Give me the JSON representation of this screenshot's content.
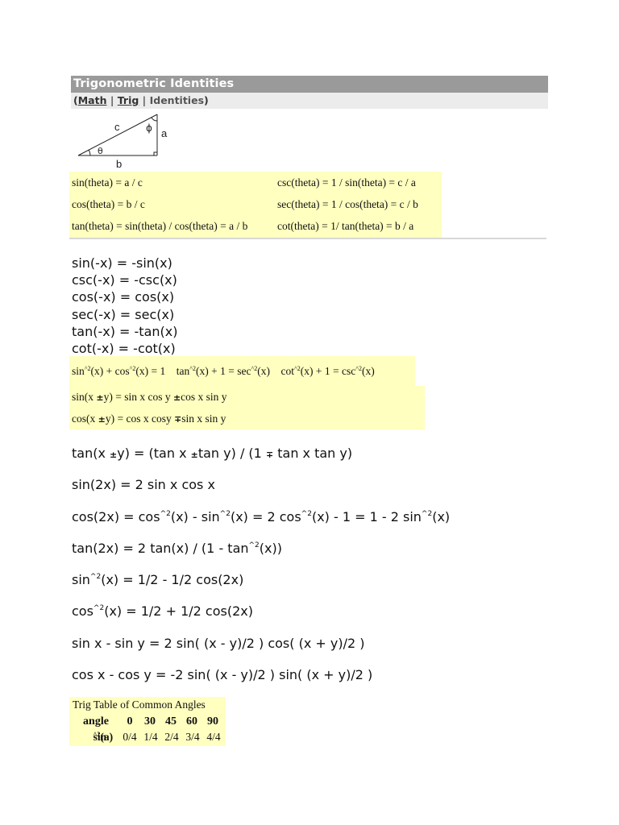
{
  "header": {
    "title": "Trigonometric Identities",
    "breadcrumb": {
      "open": "(",
      "links": [
        "Math",
        "Trig"
      ],
      "separator": " | ",
      "current": "Identities",
      "close": ")"
    }
  },
  "diagram": {
    "labels": {
      "hyp": "c",
      "opp": "a",
      "adj": "b",
      "angle_theta": "θ",
      "angle_phi": "ϕ"
    }
  },
  "definitions": [
    {
      "left": "sin(theta) = a / c",
      "right": "csc(theta) = 1 / sin(theta) = c / a"
    },
    {
      "left": "cos(theta) = b / c",
      "right": "sec(theta) = 1 / cos(theta) = c / b"
    },
    {
      "left": "tan(theta) = sin(theta) / cos(theta) = a / b",
      "right": "cot(theta) = 1/ tan(theta) = b / a"
    }
  ],
  "negative_angle": [
    "sin(-x) = -sin(x)",
    "csc(-x) = -csc(x)",
    "cos(-x) = cos(x)",
    "sec(-x) = sec(x)",
    "tan(-x) = -tan(x)",
    "cot(-x) = -cot(x)"
  ],
  "pythagorean": {
    "p1": {
      "a": "sin",
      "b": "(x) + cos",
      "c": "(x) = 1"
    },
    "p2": {
      "a": "tan",
      "b": "(x) + 1 = sec",
      "c": "(x)"
    },
    "p3": {
      "a": "cot",
      "b": "(x) + 1 = csc",
      "c": "(x)"
    },
    "exp": "^2"
  },
  "sum_difference": {
    "sin": {
      "a": "sin(x ",
      "pm": "±",
      "b": "y) = sin x cos y ",
      "pm2": "±",
      "c": "cos x sin y"
    },
    "cos": {
      "a": "cos(x ",
      "pm": "±",
      "b": "y) = cos x cosy ",
      "mp": "∓",
      "c": "sin x sin y"
    }
  },
  "formulas": {
    "tan_sum": {
      "a": "tan(x ",
      "pm": "±",
      "b": "y) = (tan x ",
      "pm2": "±",
      "c": "tan y) / (1 ",
      "mp": "∓",
      "d": " tan x tan y)"
    },
    "sin_double": "sin(2x) = 2 sin x cos x",
    "cos_double": {
      "a": "cos(2x) = cos",
      "b": "(x) - sin",
      "c": "(x) = 2 cos",
      "d": "(x) - 1 = 1 - 2 sin",
      "e": "(x)"
    },
    "tan_double": {
      "a": "tan(2x) = 2 tan(x) / (1 - tan",
      "b": "(x))"
    },
    "sin_sq": {
      "a": "sin",
      "b": "(x) = 1/2 - 1/2 cos(2x)"
    },
    "cos_sq": {
      "a": "cos",
      "b": "(x) = 1/2 + 1/2 cos(2x)"
    },
    "sin_diff": "sin x - sin y = 2 sin( (x - y)/2 ) cos( (x + y)/2 )",
    "cos_diff": "cos x - cos y = -2 sin( (x - y)/2 ) sin( (x + y)/2 )",
    "exp": "^2"
  },
  "angles_table": {
    "caption": "Trig Table of Common Angles",
    "header_label": "angle",
    "angles": [
      "0",
      "30",
      "45",
      "60",
      "90"
    ],
    "row_label_a": "sin",
    "row_label_exp": "^2",
    "row_label_b": "(a)",
    "values": [
      "0/4",
      "1/4",
      "2/4",
      "3/4",
      "4/4"
    ]
  },
  "colors": {
    "title_bg": "#9a9a9a",
    "breadcrumb_bg": "#ececec",
    "highlight_bg": "#ffffc0"
  }
}
